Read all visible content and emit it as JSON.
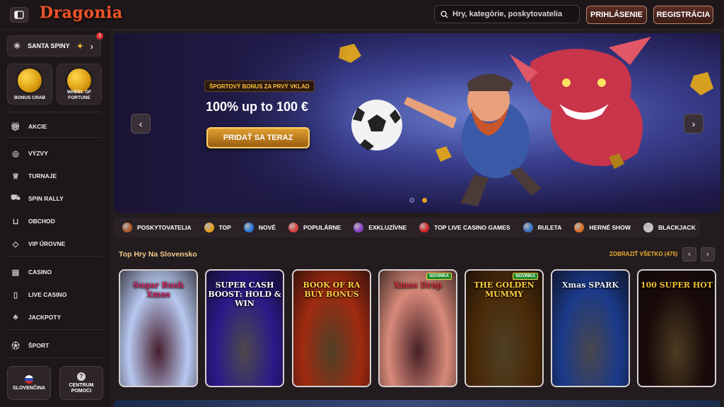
{
  "header": {
    "logo_text": "Dragonia",
    "search_placeholder": "Hry, kategórie, poskytovatelia",
    "login_label": "PRIHLÁSENIE",
    "register_label": "REGISTRÁCIA"
  },
  "sidebar": {
    "santa_label": "SANTA SPINY",
    "santa_badge": "1",
    "tiles": [
      {
        "label": "BONUS CRAB"
      },
      {
        "label": "WHEEL OF FORTUNE"
      }
    ],
    "items": [
      {
        "label": "AKCIE",
        "icon": "gift-icon"
      },
      {
        "label": "VÝZVY",
        "icon": "medal-icon"
      },
      {
        "label": "TURNAJE",
        "icon": "trophy-icon"
      },
      {
        "label": "SPIN RALLY",
        "icon": "car-icon"
      },
      {
        "label": "OBCHOD",
        "icon": "basket-icon"
      },
      {
        "label": "VIP ÚROVNE",
        "icon": "diamond-icon"
      },
      {
        "label": "CASINO",
        "icon": "slot-machine-icon"
      },
      {
        "label": "LIVE CASINO",
        "icon": "playing-card-icon"
      },
      {
        "label": "JACKPOTY",
        "icon": "clover-icon"
      },
      {
        "label": "ŠPORT",
        "icon": "soccer-ball-icon"
      }
    ],
    "language_label": "SLOVENČINA",
    "help_label": "CENTRUM POMOCI"
  },
  "banner": {
    "tag": "ŠPORTOVÝ BONUS ZA PRVÝ VKLAD",
    "title": "100% up to 100 €",
    "cta": "PRIDAŤ SA TERAZ",
    "slides": 2,
    "active_slide": 2
  },
  "categories": [
    {
      "label": "POSKYTOVATELIA",
      "color": "#b05a2a"
    },
    {
      "label": "TOP",
      "color": "#e0a020"
    },
    {
      "label": "NOVÉ",
      "color": "#2a7ad8"
    },
    {
      "label": "POPULÁRNE",
      "color": "#d84040"
    },
    {
      "label": "EXKLUZÍVNE",
      "color": "#8a40c8"
    },
    {
      "label": "TOP LIVE CASINO GAMES",
      "color": "#d82828"
    },
    {
      "label": "RULETA",
      "color": "#3a70c0"
    },
    {
      "label": "HERNÉ SHOW",
      "color": "#d8702a"
    },
    {
      "label": "BLACKJACK",
      "color": "#c8c0c4"
    }
  ],
  "section": {
    "title": "Top Hry Na Slovensko",
    "view_all": "ZOBRAZIŤ VŠETKO (475)"
  },
  "games": [
    {
      "title": "Sugar Rush Xmas",
      "bg": "#b8c8f0",
      "color": "#d82a6a"
    },
    {
      "title": "SUPER CASH BOOST: HOLD & WIN",
      "bg": "#2a1a8a",
      "color": "#ffffff"
    },
    {
      "title": "BOOK OF RA BUY BONUS",
      "bg": "#a02a10",
      "color": "#ffd040"
    },
    {
      "title": "Xmas Drop",
      "bg": "#d88a7a",
      "color": "#d83040",
      "tag": "NOVINKA"
    },
    {
      "title": "THE GOLDEN MUMMY",
      "bg": "#4a2a08",
      "color": "#ffd040",
      "tag": "NOVINKA"
    },
    {
      "title": "Xmas SPARK",
      "bg": "#1a3a8a",
      "color": "#e8f0ff"
    },
    {
      "title": "100 SUPER HOT",
      "bg": "#1a0a0a",
      "color": "#f0c030"
    }
  ]
}
